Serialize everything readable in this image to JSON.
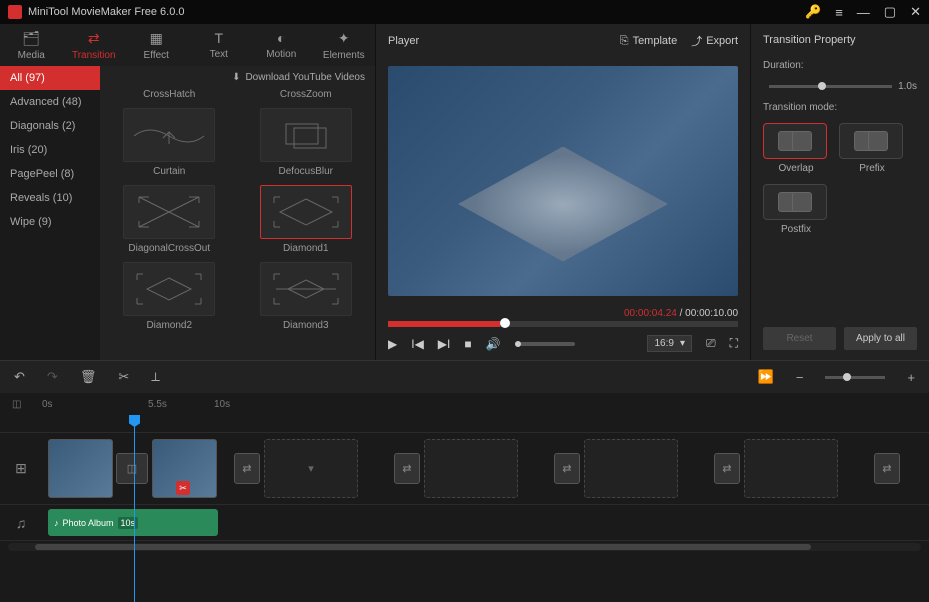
{
  "app_title": "MiniTool MovieMaker Free 6.0.0",
  "tabs": [
    {
      "icon": "folder",
      "label": "Media"
    },
    {
      "icon": "transition",
      "label": "Transition"
    },
    {
      "icon": "effect",
      "label": "Effect"
    },
    {
      "icon": "text",
      "label": "Text"
    },
    {
      "icon": "motion",
      "label": "Motion"
    },
    {
      "icon": "elements",
      "label": "Elements"
    }
  ],
  "categories": [
    "All (97)",
    "Advanced (48)",
    "Diagonals (2)",
    "Iris (20)",
    "PagePeel (8)",
    "Reveals (10)",
    "Wipe (9)"
  ],
  "download_label": "Download YouTube Videos",
  "thumbs": [
    [
      "CrossHatch",
      "CrossZoom"
    ],
    [
      "Curtain",
      "DefocusBlur"
    ],
    [
      "DiagonalCrossOut",
      "Diamond1"
    ],
    [
      "Diamond2",
      "Diamond3"
    ]
  ],
  "selected_thumb": "Diamond1",
  "player": {
    "title": "Player",
    "template_label": "Template",
    "export_label": "Export",
    "time_current": "00:00:04.24",
    "time_total": "00:00:10.00",
    "aspect": "16:9"
  },
  "property": {
    "title": "Transition Property",
    "duration_label": "Duration:",
    "duration_value": "1.0s",
    "mode_label": "Transition mode:",
    "modes": [
      "Overlap",
      "Prefix",
      "Postfix"
    ],
    "selected_mode": "Overlap",
    "reset_label": "Reset",
    "apply_label": "Apply to all"
  },
  "timeline": {
    "marks": [
      "0s",
      "5.5s",
      "10s"
    ],
    "audio_clip": "Photo Album",
    "audio_len_badge": "10s"
  }
}
